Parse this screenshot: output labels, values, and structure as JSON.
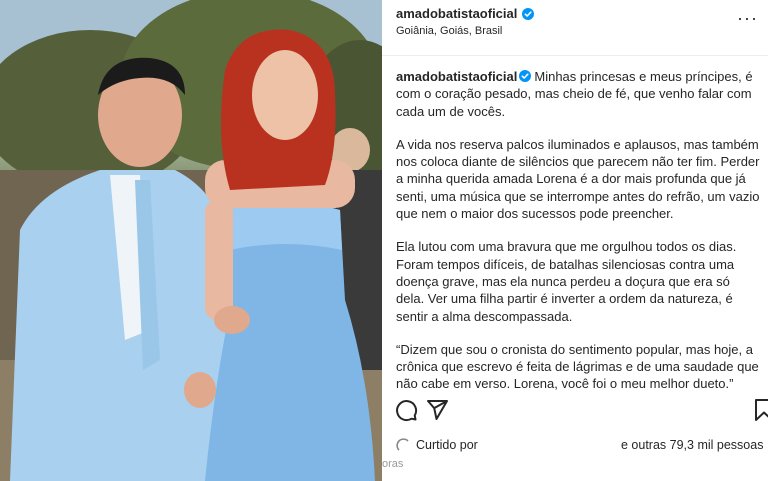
{
  "post": {
    "username": "amadobatistaoficial",
    "location": "Goiânia, Goiás, Brasil",
    "caption_username": "amadobatistaoficial",
    "paragraph1": "Minhas princesas e meus príncipes, é com o coração pesado, mas cheio de fé, que venho falar com cada um de vocês.",
    "paragraph2": "A vida nos reserva palcos iluminados e aplausos, mas também nos coloca diante de silêncios que parecem não ter fim. Perder a minha querida amada Lorena é a dor mais profunda que já senti, uma música que se interrompe antes do refrão, um vazio que nem o maior dos sucessos pode preencher.",
    "paragraph3": "Ela lutou com uma bravura que me orgulhou todos os dias. Foram tempos difíceis, de batalhas silenciosas contra uma doença grave, mas ela nunca perdeu a doçura que era só dela. Ver uma filha partir é inverter a ordem da natureza, é sentir a alma descompassada.",
    "paragraph4": "“Dizem que sou o cronista do sentimento popular, mas hoje, a crônica que escrevo é feita de lágrimas e de uma saudade que não cabe em verso. Lorena, você foi o meu melhor dueto.”",
    "liked_prefix": "Curtido por",
    "liked_others": "e outras 79,3 mil pessoas",
    "faded_text": "oras"
  },
  "icons": {
    "verified": "verified-badge-icon",
    "more": "more-options-icon",
    "comment": "comment-icon",
    "share": "share-icon",
    "save": "bookmark-icon"
  },
  "colors": {
    "verified": "#0095f6",
    "text": "#262626",
    "suit": "#a9d0ee",
    "dress": "#7fb6e6",
    "hair": "#b8321f"
  }
}
